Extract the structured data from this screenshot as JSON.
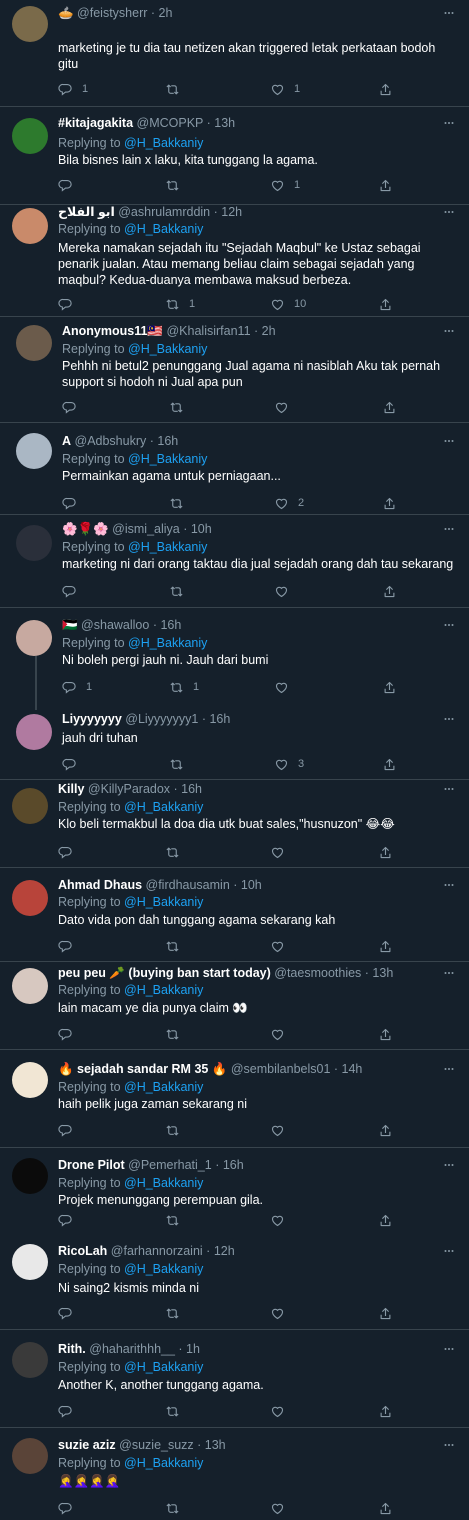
{
  "colors": {
    "background": "#15202b",
    "divider": "#38444d",
    "muted": "#8899a6",
    "mention": "#1da1f2",
    "text": "#ffffff"
  },
  "reply_prefix": "Replying to",
  "reply_target": "@H_Bakkaniy",
  "sep": "·",
  "tweets": [
    {
      "name_prefix": "🥧",
      "name": "",
      "handle": "@feistysherr",
      "time": "2h",
      "show_reply": false,
      "text": "marketing je tu dia tau netizen akan triggered letak perkataan bodoh gitu",
      "replies": "1",
      "retweets": "",
      "likes": "1"
    },
    {
      "name": "#kitajagakita",
      "handle": "@MCOPKP",
      "time": "13h",
      "show_reply": true,
      "text": "Bila bisnes lain x laku, kita tunggang la agama.",
      "replies": "",
      "retweets": "",
      "likes": "1"
    },
    {
      "name": "ابو الفلاح",
      "handle": "@ashrulamrddin",
      "time": "12h",
      "show_reply": true,
      "text": "Mereka namakan sejadah itu \"Sejadah Maqbul\"  ke Ustaz sebagai penarik jualan. Atau memang beliau claim sebagai sejadah yang maqbul? Kedua-duanya membawa maksud berbeza.",
      "replies": "",
      "retweets": "1",
      "likes": "10"
    },
    {
      "name": "Anonymous11🇲🇾",
      "handle": "@Khalisirfan11",
      "time": "2h",
      "show_reply": true,
      "text": "Pehhh ni betul2 penunggang Jual agama ni nasiblah Aku tak pernah support si hodoh ni Jual apa pun",
      "replies": "",
      "retweets": "",
      "likes": ""
    },
    {
      "name": "A",
      "handle": "@Adbshukry",
      "time": "16h",
      "show_reply": true,
      "text": "Permainkan agama untuk perniagaan...",
      "replies": "",
      "retweets": "",
      "likes": "2"
    },
    {
      "name": "🌸🌹🌸",
      "handle": "@ismi_aliya",
      "time": "10h",
      "show_reply": true,
      "text": "marketing ni dari orang taktau dia jual sejadah orang dah tau sekarang",
      "replies": "",
      "retweets": "",
      "likes": ""
    },
    {
      "name": "🇵🇸",
      "handle": "@shawalloo",
      "time": "16h",
      "show_reply": true,
      "text": "Ni boleh pergi jauh ni. Jauh dari bumi",
      "replies": "1",
      "retweets": "1",
      "likes": ""
    },
    {
      "name": "Liyyyyyyy",
      "handle": "@Liyyyyyyy1",
      "time": "16h",
      "show_reply": false,
      "text": "jauh dri tuhan",
      "replies": "",
      "retweets": "",
      "likes": "3"
    },
    {
      "name": "Killy",
      "handle": "@KillyParadox",
      "time": "16h",
      "show_reply": true,
      "text": "Klo beli termakbul la doa dia utk buat sales,\"husnuzon\" 😂😂",
      "replies": "",
      "retweets": "",
      "likes": ""
    },
    {
      "name": "Ahmad Dhaus",
      "handle": "@firdhausamin",
      "time": "10h",
      "show_reply": true,
      "text": "Dato vida pon dah tunggang agama sekarang kah",
      "replies": "",
      "retweets": "",
      "likes": ""
    },
    {
      "name": "peu peu 🥕 (buying ban start today)",
      "handle": "@taesmoothies",
      "time": "13h",
      "show_reply": true,
      "text": "lain macam ye dia punya claim 👀",
      "replies": "",
      "retweets": "",
      "likes": ""
    },
    {
      "name": "🔥 sejadah sandar RM 35 🔥",
      "handle": "@sembilanbels01",
      "time": "14h",
      "show_reply": true,
      "text": "haih pelik juga zaman sekarang ni",
      "replies": "",
      "retweets": "",
      "likes": ""
    },
    {
      "name": "Drone Pilot",
      "handle": "@Pemerhati_1",
      "time": "16h",
      "show_reply": true,
      "text": "Projek menunggang perempuan gila.",
      "replies": "",
      "retweets": "",
      "likes": ""
    },
    {
      "name": "RicoLah",
      "handle": "@farhannorzaini",
      "time": "12h",
      "show_reply": true,
      "text": "Ni saing2 kismis minda ni",
      "replies": "",
      "retweets": "",
      "likes": ""
    },
    {
      "name": "Rith.",
      "handle": "@haharithhh__",
      "time": "1h",
      "show_reply": true,
      "text": "Another K, another tunggang agama.",
      "replies": "",
      "retweets": "",
      "likes": ""
    },
    {
      "name": "suzie aziz",
      "handle": "@suzie_suzz",
      "time": "13h",
      "show_reply": true,
      "text": "🤦‍♀️🤦‍♀️🤦‍♀️🤦‍♀️",
      "replies": "",
      "retweets": "",
      "likes": ""
    }
  ]
}
